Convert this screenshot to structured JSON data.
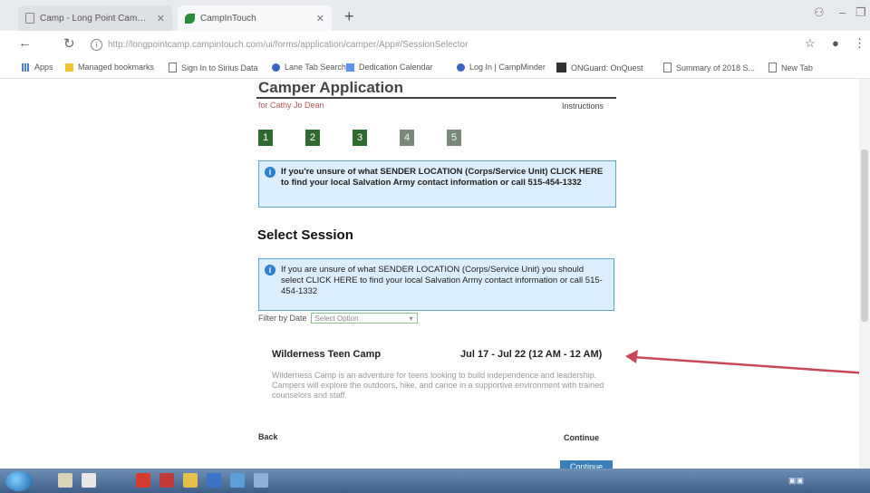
{
  "browser": {
    "tabs": [
      {
        "title": "Camp - Long Point Camp | The"
      },
      {
        "title": "CampInTouch"
      }
    ],
    "url": "http://longpointcamp.campintouch.com/ui/forms/application/camper/App#/SessionSelector",
    "bookmarks": [
      {
        "label": "Apps",
        "icon": "apps-grid-icon"
      },
      {
        "label": "Managed bookmarks",
        "icon": "folder-icon"
      },
      {
        "label": "Sign In to Sirius Data",
        "icon": "page-icon"
      },
      {
        "label": "Lane Tab Search",
        "icon": "search-icon"
      },
      {
        "label": "Dedication Calendar",
        "icon": "calendar-icon"
      },
      {
        "label": "Log In | CampMinder",
        "icon": "campminder-icon"
      },
      {
        "label": "ONGuard: OnQuest",
        "icon": "box-icon"
      },
      {
        "label": "Summary of 2018 S...",
        "icon": "page-icon"
      },
      {
        "label": "New Tab",
        "icon": "page-icon"
      }
    ]
  },
  "app": {
    "title": "Camper Application",
    "subtitle": "for Cathy Jo Dean",
    "instructions_link": "Instructions",
    "steps": [
      "1",
      "2",
      "3",
      "4",
      "5"
    ],
    "notice1": "If you're unsure of what SENDER LOCATION (Corps/Service Unit) CLICK HERE to find your local Salvation Army contact information or call 515-454-1332",
    "section_heading": "Select Session",
    "notice2": "If you are unsure of what SENDER LOCATION (Corps/Service Unit) you should select CLICK HERE to find your local Salvation Army contact information or call 515-454-1332",
    "filter_label": "Filter by Date",
    "filter_value": "Select Option",
    "session": {
      "name": "Wilderness Teen Camp",
      "dates": "Jul 17 - Jul 22 (12 AM - 12 AM)",
      "description": "Wilderness Camp is an adventure for teens looking to build independence and leadership. Campers will explore the outdoors, hike, and canoe in a supportive environment with trained counselors and staff."
    },
    "back_label": "Back",
    "continue_label": "Continue",
    "continue_button": "Continue"
  },
  "colors": {
    "step_active": "#2f6a2f",
    "notice_border": "#59a7e0",
    "annotation_arrow": "#c8485a"
  }
}
